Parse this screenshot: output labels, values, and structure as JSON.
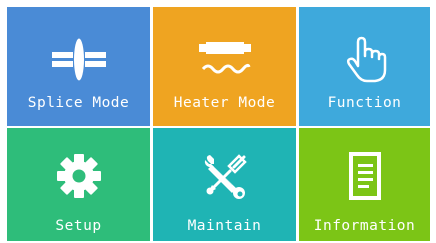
{
  "menu": {
    "tiles": [
      {
        "label": "Splice Mode",
        "icon": "splice-icon",
        "color": "#4a8bd6"
      },
      {
        "label": "Heater Mode",
        "icon": "heater-icon",
        "color": "#efa421"
      },
      {
        "label": "Function",
        "icon": "hand-pointer-icon",
        "color": "#3ea9dc"
      },
      {
        "label": "Setup",
        "icon": "gear-icon",
        "color": "#2ebd7a"
      },
      {
        "label": "Maintain",
        "icon": "wrench-screwdriver-icon",
        "color": "#1fb4b4"
      },
      {
        "label": "Information",
        "icon": "document-icon",
        "color": "#7cc516"
      }
    ]
  }
}
